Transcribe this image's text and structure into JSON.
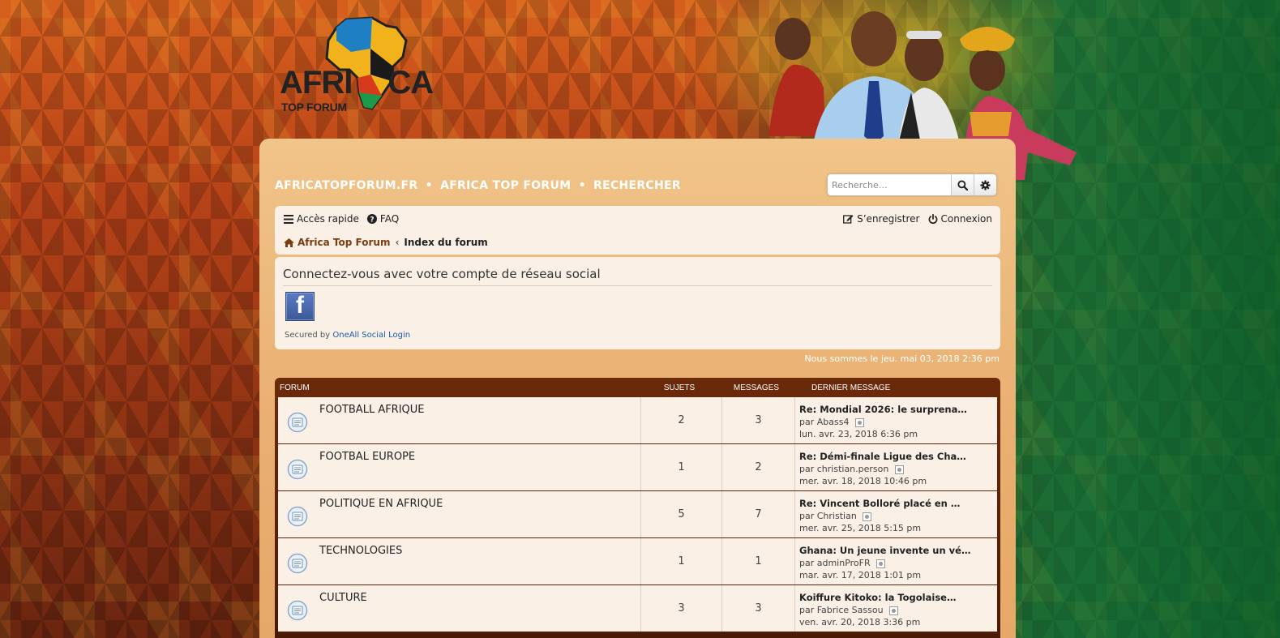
{
  "logo": {
    "text_left": "AFRI",
    "text_right": "CA",
    "subtitle": "TOP FORUM"
  },
  "sitebar": {
    "items": [
      "AFRICATOPFORUM.FR",
      "AFRICA TOP FORUM",
      "RECHERCHER"
    ],
    "separator": "•"
  },
  "search": {
    "placeholder": "Recherche…"
  },
  "nav": {
    "quick_access": "Accès rapide",
    "faq": "FAQ",
    "register": "S’enregistrer",
    "login": "Connexion"
  },
  "breadcrumb": {
    "home": "Africa Top Forum",
    "separator": "‹",
    "current": "Index du forum"
  },
  "social": {
    "title": "Connectez-vous avec votre compte de réseau social",
    "facebook_glyph": "f",
    "secured_by": "Secured by",
    "secured_link": "OneAll Social Login"
  },
  "date_line": "Nous sommes le jeu. mai 03, 2018 2:36 pm",
  "forum_table": {
    "headers": {
      "forum": "FORUM",
      "sujets": "SUJETS",
      "messages": "MESSAGES",
      "last": "DERNIER MESSAGE"
    },
    "rows": [
      {
        "name": "FOOTBALL AFRIQUE",
        "sujets": "2",
        "messages": "3",
        "last_title": "Re: Mondial 2026: le surprena…",
        "last_by": "par Abass4",
        "last_date": "lun. avr. 23, 2018 6:36 pm"
      },
      {
        "name": "FOOTBAL EUROPE",
        "sujets": "1",
        "messages": "2",
        "last_title": "Re: Démi-finale Ligue des Cha…",
        "last_by": "par christian.person",
        "last_date": "mer. avr. 18, 2018 10:46 pm"
      },
      {
        "name": "POLITIQUE EN AFRIQUE",
        "sujets": "5",
        "messages": "7",
        "last_title": "Re: Vincent Bolloré placé en …",
        "last_by": "par Christian",
        "last_date": "mer. avr. 25, 2018 5:15 pm"
      },
      {
        "name": "TECHNOLOGIES",
        "sujets": "1",
        "messages": "1",
        "last_title": "Ghana: Un jeune invente un vé…",
        "last_by": "par adminProFR",
        "last_date": "mar. avr. 17, 2018 1:01 pm"
      },
      {
        "name": "CULTURE",
        "sujets": "3",
        "messages": "3",
        "last_title": "Koiffure Kitoko: la Togolaise…",
        "last_by": "par Fabrice Sassou",
        "last_date": "ven. avr. 20, 2018 3:36 pm"
      }
    ]
  },
  "colors": {
    "panel": "#f1c489",
    "header_bar": "#6b2a0a",
    "row_bg": "#fbf0e6",
    "link_blue": "#1a5aa6",
    "facebook": "#3b5998"
  }
}
